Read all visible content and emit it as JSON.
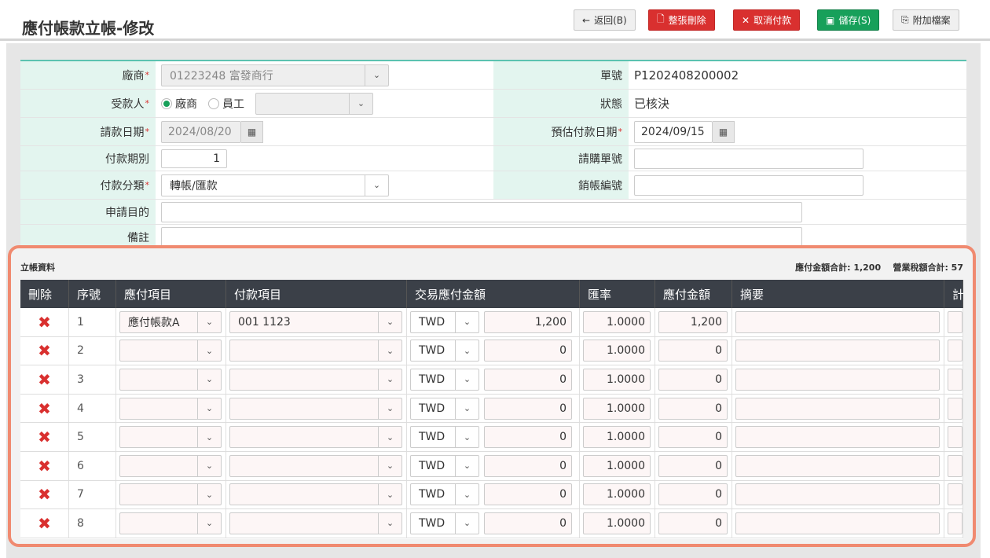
{
  "page": {
    "title": "應付帳款立帳-修改"
  },
  "toolbar": {
    "back": "返回(B)",
    "delete_all": "整張刪除",
    "cancel_pay": "取消付款",
    "save": "儲存(S)",
    "attach": "附加檔案"
  },
  "form": {
    "vendor": {
      "label": "廠商",
      "value": "01223248 富發商行"
    },
    "doc_no": {
      "label": "單號",
      "value": "P1202408200002"
    },
    "payee": {
      "label": "受款人",
      "opt_vendor": "廠商",
      "opt_employee": "員工",
      "selected": "廠商"
    },
    "status": {
      "label": "狀態",
      "value": "已核決"
    },
    "request_date": {
      "label": "請款日期",
      "value": "2024/08/20"
    },
    "est_pay_date": {
      "label": "預估付款日期",
      "value": "2024/09/15"
    },
    "pay_period": {
      "label": "付款期別",
      "value": "1"
    },
    "purchase_no": {
      "label": "請購單號",
      "value": ""
    },
    "pay_category": {
      "label": "付款分類",
      "value": "轉帳/匯款"
    },
    "writeoff_no": {
      "label": "銷帳編號",
      "value": ""
    },
    "purpose": {
      "label": "申請目的",
      "value": ""
    },
    "remark": {
      "label": "備註",
      "value": ""
    }
  },
  "detail": {
    "title": "立帳資料",
    "summary_total": "應付金額合計: 1,200",
    "summary_tax": "營業稅額合計: 57",
    "columns": [
      "刪除",
      "序號",
      "應付項目",
      "付款項目",
      "交易應付金額",
      "匯率",
      "應付金額",
      "摘要",
      "計"
    ],
    "rows": [
      {
        "no": "1",
        "item": "應付帳款A",
        "pay_item": "001 1123",
        "currency": "TWD",
        "amount": "1,200",
        "rate": "1.0000",
        "pay_amount": "1,200",
        "memo": ""
      },
      {
        "no": "2",
        "item": "",
        "pay_item": "",
        "currency": "TWD",
        "amount": "0",
        "rate": "1.0000",
        "pay_amount": "0",
        "memo": ""
      },
      {
        "no": "3",
        "item": "",
        "pay_item": "",
        "currency": "TWD",
        "amount": "0",
        "rate": "1.0000",
        "pay_amount": "0",
        "memo": ""
      },
      {
        "no": "4",
        "item": "",
        "pay_item": "",
        "currency": "TWD",
        "amount": "0",
        "rate": "1.0000",
        "pay_amount": "0",
        "memo": ""
      },
      {
        "no": "5",
        "item": "",
        "pay_item": "",
        "currency": "TWD",
        "amount": "0",
        "rate": "1.0000",
        "pay_amount": "0",
        "memo": ""
      },
      {
        "no": "6",
        "item": "",
        "pay_item": "",
        "currency": "TWD",
        "amount": "0",
        "rate": "1.0000",
        "pay_amount": "0",
        "memo": ""
      },
      {
        "no": "7",
        "item": "",
        "pay_item": "",
        "currency": "TWD",
        "amount": "0",
        "rate": "1.0000",
        "pay_amount": "0",
        "memo": ""
      },
      {
        "no": "8",
        "item": "",
        "pay_item": "",
        "currency": "TWD",
        "amount": "0",
        "rate": "1.0000",
        "pay_amount": "0",
        "memo": ""
      }
    ]
  },
  "colors": {
    "accent": "#5cc2b0",
    "danger": "#d9302f",
    "success": "#17a05a",
    "highlight": "#f08a70"
  }
}
